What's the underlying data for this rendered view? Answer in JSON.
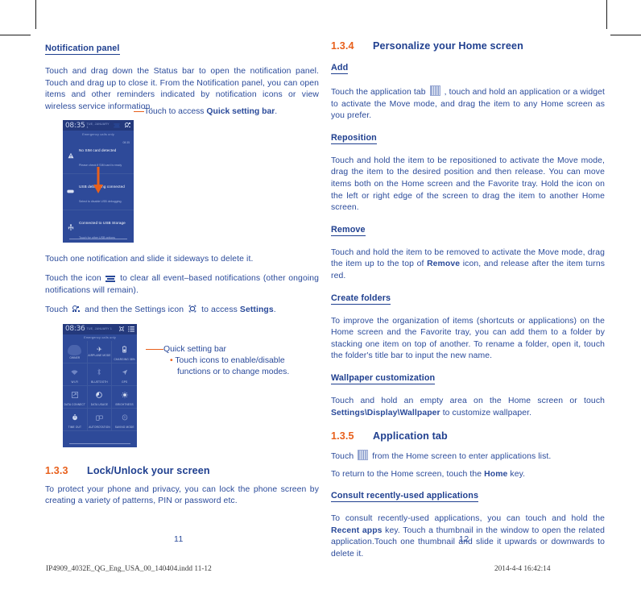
{
  "document": {
    "left_page_number": "11",
    "right_page_number": "12",
    "footer_file": "IP4909_4032E_QG_Eng_USA_00_140404.indd   11-12",
    "footer_timestamp": "2014-4-4   16:42:14"
  },
  "left_page": {
    "heading_notification": "Notification panel",
    "para_notification": "Touch and drag down the Status bar to open the notification panel. Touch and drag up to close it. From the Notification panel, you can open items and other reminders indicated by notification icons or view wireless service information.",
    "callout_quick_setting_pre": "Touch to access ",
    "callout_quick_setting_bold": "Quick setting bar",
    "callout_quick_setting_post": ".",
    "para_slide_delete": "Touch one notification and slide it sideways to delete it.",
    "para_clear_pre": "Touch the icon ",
    "para_clear_post": " to clear all event–based notifications (other ongoing notifications will remain).",
    "para_settings_pre": "Touch ",
    "para_settings_mid": " and then the Settings icon ",
    "para_settings_post": " to access ",
    "para_settings_bold": "Settings",
    "para_settings_end": ".",
    "callout_qsbar_title": "Quick setting bar",
    "callout_qsbar_line1": "Touch icons to enable/disable",
    "callout_qsbar_line2": "functions or to change modes.",
    "callout_qsbar_bullet": "•",
    "section_lock": {
      "number": "1.3.3",
      "title": "Lock/Unlock your screen",
      "body": "To protect your phone and privacy, you can lock the phone screen by creating a variety of patterns, PIN or password etc."
    }
  },
  "right_page": {
    "section_personalize": {
      "number": "1.3.4",
      "title": "Personalize your Home screen"
    },
    "add": {
      "heading": "Add",
      "text_pre": "Touch the application tab ",
      "text_post": " , touch and hold an application or a widget to activate the Move mode, and drag the item to any Home screen as you prefer."
    },
    "reposition": {
      "heading": "Reposition",
      "text": "Touch and hold the item to be repositioned to activate the Move mode, drag the item to the desired position and then release. You can move items both on the Home screen and the Favorite tray. Hold the icon on the left or right edge of the screen to drag the item to another Home screen."
    },
    "remove": {
      "heading": "Remove",
      "text_pre": "Touch and hold the item to be removed to activate the Move mode, drag the item up to the top of ",
      "text_bold": "Remove",
      "text_post": " icon, and release after the item turns red."
    },
    "create_folders": {
      "heading": "Create folders",
      "text": "To improve the organization of items (shortcuts or applications) on the Home screen and the Favorite tray, you can add them to a folder by stacking one item on top of another. To rename a folder, open it, touch the folder's title bar to input the new name."
    },
    "wallpaper": {
      "heading": "Wallpaper customization",
      "text_pre": "Touch and hold an empty area on the Home screen or touch ",
      "text_bold": "Settings\\Display\\Wallpaper",
      "text_post": " to customize wallpaper."
    },
    "section_apptab": {
      "number": "1.3.5",
      "title": "Application tab"
    },
    "apptab": {
      "line1_pre": "Touch ",
      "line1_post": " from the Home screen to enter applications list.",
      "line2_pre": "To return to the Home screen, touch the ",
      "line2_bold": "Home",
      "line2_post": " key."
    },
    "recent": {
      "heading": "Consult recently-used applications",
      "text_pre": "To consult recently-used applications, you can touch and hold the ",
      "text_bold": "Recent apps",
      "text_post": " key. Touch a thumbnail in the window to open the related application.Touch one thumbnail and slide it upwards or downwards to delete it."
    }
  },
  "phone_notification": {
    "clock": "08:35",
    "carrier": "TUE, JANUARY 1",
    "emergency": "Emergency calls only",
    "status_icons": [
      "clear-all-icon",
      "quick-setting-icon"
    ],
    "notifications": [
      {
        "icon": "warning-triangle-icon",
        "title": "No SIM card detected",
        "subtitle": "Please check if SIM card is ready",
        "time": "08:35"
      },
      {
        "icon": "usb-debug-icon",
        "title": "USB debugging connected",
        "subtitle": "Select to disable USB debugging.",
        "time": ""
      },
      {
        "icon": "usb-storage-icon",
        "title": "Connected to USB Storage",
        "subtitle": "Touch for other USB options",
        "time": ""
      }
    ]
  },
  "phone_quicksettings": {
    "clock": "08:36",
    "carrier": "TUE, JANUARY 1",
    "emergency": "Emergency calls only",
    "status_icons": [
      "gear-icon",
      "list-icon"
    ],
    "tiles": [
      {
        "label": "OWNER",
        "glyph": ""
      },
      {
        "label": "AIRPLANE MODE",
        "glyph": "✈"
      },
      {
        "label": "CHARGING 38%",
        "glyph": "▮"
      },
      {
        "label": "WI-FI",
        "glyph": "▲"
      },
      {
        "label": "BLUETOOTH",
        "glyph": "▮"
      },
      {
        "label": "GPS",
        "glyph": "➤"
      },
      {
        "label": "DATA CONNECT",
        "glyph": "▣"
      },
      {
        "label": "DATA USAGE",
        "glyph": "◔"
      },
      {
        "label": "BRIGHTNESS",
        "glyph": "☉"
      },
      {
        "label": "TIME OUT",
        "glyph": "⚡"
      },
      {
        "label": "AUTOROTATION",
        "glyph": "▧"
      },
      {
        "label": "SAVING MODE",
        "glyph": "⚑"
      }
    ]
  },
  "colors": {
    "text_blue": "#2a4a9a",
    "heading_blue": "#1f3f8f",
    "accent_orange": "#e8601c",
    "phone_bg": "#2e4a99"
  }
}
